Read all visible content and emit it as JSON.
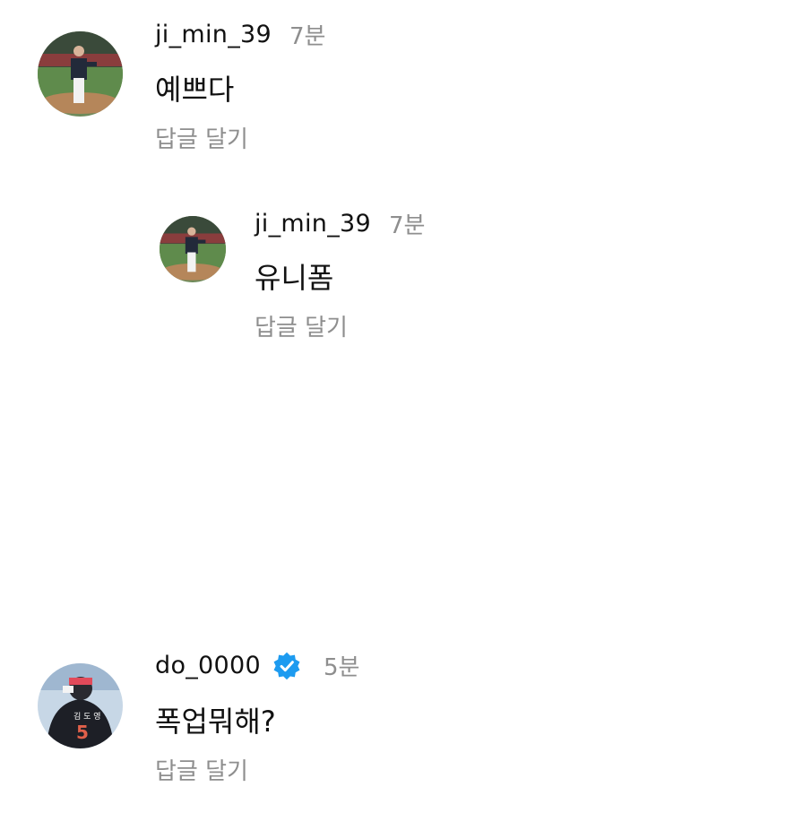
{
  "comments": [
    {
      "username": "ji_min_39",
      "time": "7분",
      "text": "예쁘다",
      "reply_label": "답글 달기"
    },
    {
      "username": "ji_min_39",
      "time": "7분",
      "text": "유니폼",
      "reply_label": "답글 달기"
    },
    {
      "username": "do_0000",
      "time": "5분",
      "text": "폭업뭐해?",
      "reply_label": "답글 달기"
    }
  ],
  "colors": {
    "text": "#111111",
    "muted": "#8e8e8e",
    "verified": "#1d9bf0"
  }
}
